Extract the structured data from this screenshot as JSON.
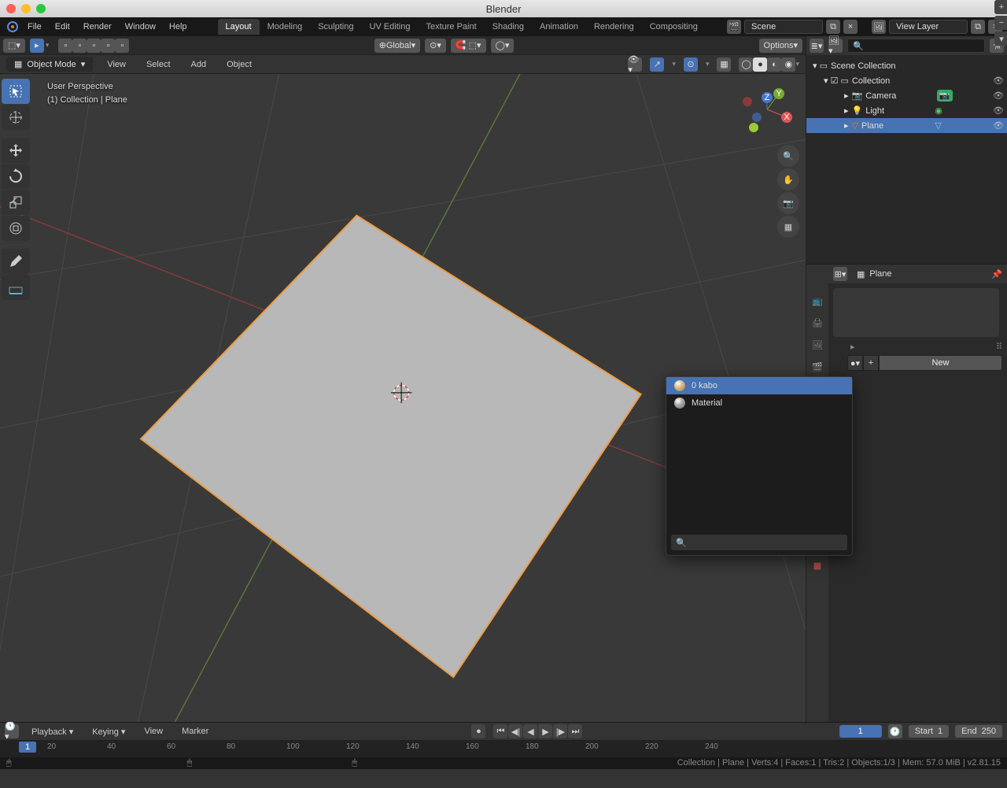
{
  "app_title": "Blender",
  "menus": [
    "File",
    "Edit",
    "Render",
    "Window",
    "Help"
  ],
  "workspaces": [
    "Layout",
    "Modeling",
    "Sculpting",
    "UV Editing",
    "Texture Paint",
    "Shading",
    "Animation",
    "Rendering",
    "Compositing"
  ],
  "active_workspace": "Layout",
  "scene_name": "Scene",
  "view_layer": "View Layer",
  "viewport": {
    "orientation": "Global",
    "options": "Options",
    "mode": "Object Mode",
    "menu_items": [
      "View",
      "Select",
      "Add",
      "Object"
    ],
    "info_line1": "User Perspective",
    "info_line2": "(1) Collection | Plane"
  },
  "outliner": {
    "root": "Scene Collection",
    "collection": "Collection",
    "items": [
      {
        "name": "Camera",
        "icon": "camera"
      },
      {
        "name": "Light",
        "icon": "light"
      },
      {
        "name": "Plane",
        "icon": "mesh",
        "selected": true
      }
    ]
  },
  "properties": {
    "object_name": "Plane",
    "new_btn": "New"
  },
  "material_popup": {
    "items": [
      {
        "label": "0 kabo",
        "selected": true,
        "color": "y"
      },
      {
        "label": "Material",
        "selected": false,
        "color": "w"
      }
    ]
  },
  "timeline": {
    "menus": [
      "Playback",
      "Keying",
      "View",
      "Marker"
    ],
    "current": "1",
    "start_lbl": "Start",
    "start": "1",
    "end_lbl": "End",
    "end": "250",
    "ticks": [
      20,
      40,
      60,
      80,
      100,
      120,
      140,
      160,
      180,
      200,
      220,
      240
    ]
  },
  "status_left": "",
  "status_right": "Collection | Plane | Verts:4 | Faces:1 | Tris:2 | Objects:1/3 | Mem: 57.0 MiB | v2.81.15"
}
